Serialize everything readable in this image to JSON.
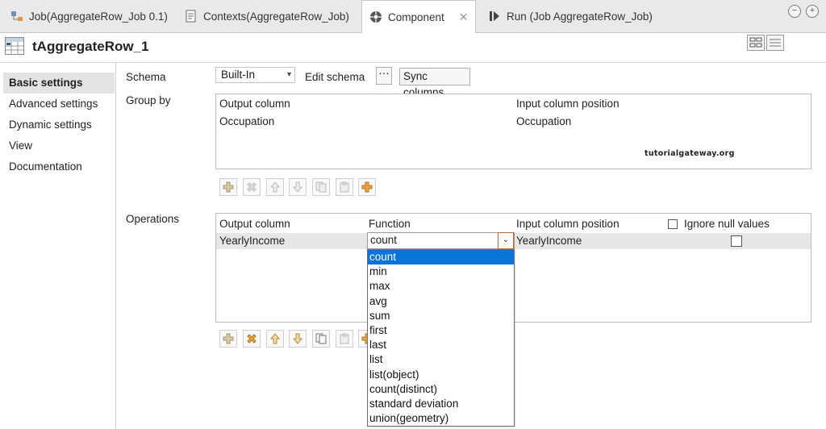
{
  "tabs": [
    {
      "label": "Job(AggregateRow_Job 0.1)",
      "icon": "job-icon"
    },
    {
      "label": "Contexts(AggregateRow_Job)",
      "icon": "contexts-icon"
    },
    {
      "label": "Component",
      "icon": "component-icon",
      "active": true,
      "close": "✕"
    },
    {
      "label": "Run (Job AggregateRow_Job)",
      "icon": "run-icon"
    }
  ],
  "window_buttons": {
    "minimize": "−",
    "maximize": "+"
  },
  "component": {
    "title": "tAggregateRow_1"
  },
  "nav": [
    "Basic settings",
    "Advanced settings",
    "Dynamic settings",
    "View",
    "Documentation"
  ],
  "schema": {
    "label": "Schema",
    "value": "Built-In",
    "edit_label": "Edit schema",
    "dots": "···",
    "sync_label": "Sync columns"
  },
  "group_by": {
    "label": "Group by",
    "headers": [
      "Output column",
      "Input column position"
    ],
    "rows": [
      [
        "Occupation",
        "Occupation"
      ]
    ],
    "watermark": "tutorialgateway.org"
  },
  "operations": {
    "label": "Operations",
    "headers": [
      "Output column",
      "Function",
      "Input column position",
      "Ignore null values"
    ],
    "row": {
      "output": "YearlyIncome",
      "function": "count",
      "input": "YearlyIncome"
    }
  },
  "function_options": [
    "count",
    "min",
    "max",
    "avg",
    "sum",
    "first",
    "last",
    "list",
    "list(object)",
    "count(distinct)",
    "standard deviation",
    "union(geometry)"
  ],
  "selected_option": "count",
  "colors": {
    "accent": "#0a74da",
    "toolbar_orange": "#e8a43a"
  }
}
